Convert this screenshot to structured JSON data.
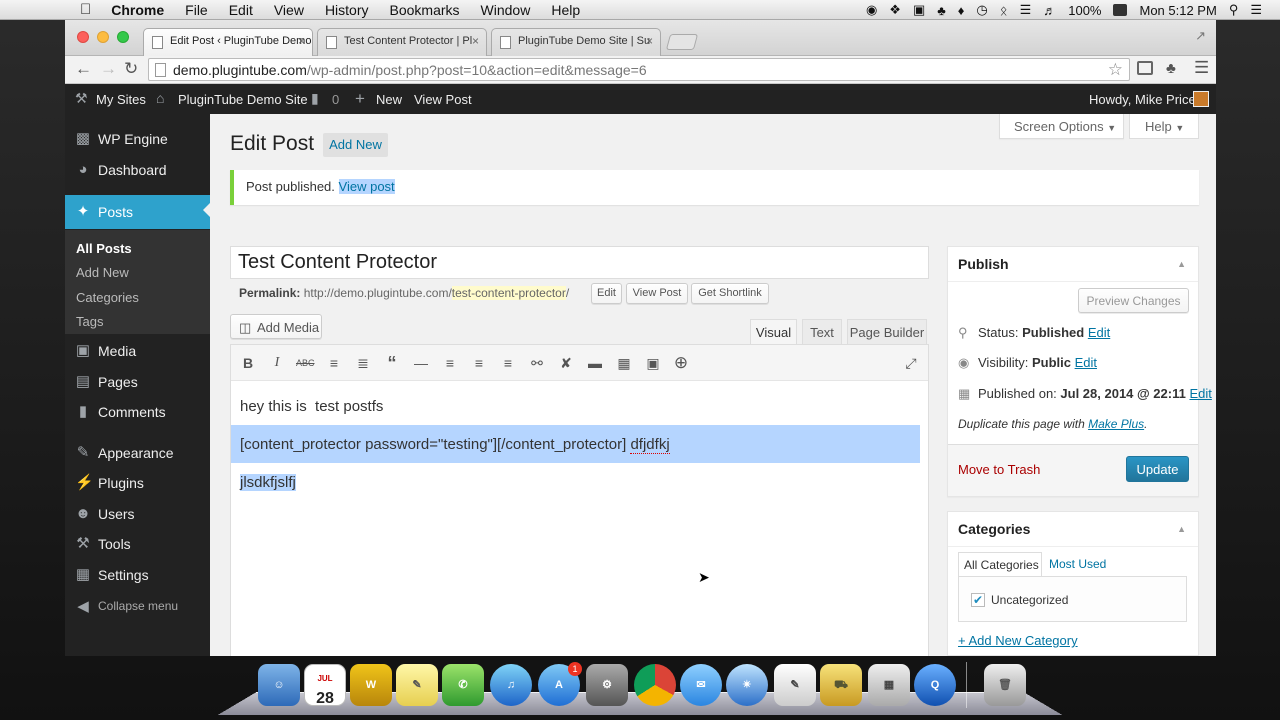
{
  "mac_menubar": {
    "app": "Chrome",
    "menus": [
      "File",
      "Edit",
      "View",
      "History",
      "Bookmarks",
      "Window",
      "Help"
    ],
    "battery": "100%",
    "clock": "Mon 5:12 PM"
  },
  "browser": {
    "tabs": [
      {
        "title": "Edit Post ‹ PluginTube Demo"
      },
      {
        "title": "Test Content Protector | Pl"
      },
      {
        "title": "PluginTube Demo Site | Su"
      }
    ],
    "url_host": "demo.plugintube.com",
    "url_path": "/wp-admin/post.php?post=10&action=edit&message=6"
  },
  "adminbar": {
    "my_sites": "My Sites",
    "site_name": "PluginTube Demo Site",
    "comments_count": "0",
    "new": "New",
    "view_post": "View Post",
    "howdy": "Howdy, Mike Price"
  },
  "sidebar": {
    "items": [
      {
        "label": "WP Engine",
        "icon": "wp-engine-icon"
      },
      {
        "label": "Dashboard",
        "icon": "dashboard-icon"
      },
      {
        "label": "Posts",
        "icon": "pin-icon"
      },
      {
        "label": "Media",
        "icon": "media-icon"
      },
      {
        "label": "Pages",
        "icon": "pages-icon"
      },
      {
        "label": "Comments",
        "icon": "comment-icon"
      },
      {
        "label": "Appearance",
        "icon": "brush-icon"
      },
      {
        "label": "Plugins",
        "icon": "plugin-icon"
      },
      {
        "label": "Users",
        "icon": "users-icon"
      },
      {
        "label": "Tools",
        "icon": "wrench-icon"
      },
      {
        "label": "Settings",
        "icon": "settings-icon"
      }
    ],
    "submenu": [
      "All Posts",
      "Add New",
      "Categories",
      "Tags"
    ],
    "collapse": "Collapse menu"
  },
  "page": {
    "screen_options": "Screen Options",
    "help": "Help",
    "title": "Edit Post",
    "add_new": "Add New",
    "notice_text": "Post published.",
    "notice_link": "View post",
    "post_title": "Test Content Protector",
    "permalink_label": "Permalink:",
    "permalink_base": "http://demo.plugintube.com/",
    "permalink_slug": "test-content-protector",
    "permalink_tail": "/",
    "edit_btn": "Edit",
    "view_post_btn": "View Post",
    "shortlink_btn": "Get Shortlink",
    "add_media": "Add Media",
    "editor_tabs": [
      "Visual",
      "Text",
      "Page Builder"
    ],
    "content_line1": "hey this is  test postfs",
    "content_line2": "[content_protector password=\"testing\"][/content_protector]",
    "content_line2_sel": "dfjdfkj",
    "content_line3": "jlsdkfjslfj"
  },
  "publish_box": {
    "title": "Publish",
    "preview": "Preview Changes",
    "status_label": "Status:",
    "status_value": "Published",
    "visibility_label": "Visibility:",
    "visibility_value": "Public",
    "published_label": "Published on:",
    "published_value": "Jul 28, 2014 @ 22:11",
    "edit": "Edit",
    "duplicate_text": "Duplicate this page with",
    "duplicate_link": "Make Plus",
    "trash": "Move to Trash",
    "update": "Update"
  },
  "categories_box": {
    "title": "Categories",
    "tabs": [
      "All Categories",
      "Most Used"
    ],
    "items": [
      {
        "label": "Uncategorized",
        "checked": true
      }
    ],
    "add_new": "+ Add New Category"
  },
  "dock": {
    "calendar_day": "28",
    "calendar_month": "JUL",
    "badge": "1"
  },
  "colors": {
    "wp_blue": "#2ea2cc",
    "admin_dark": "#222222",
    "link": "#0074a2",
    "notice_green": "#7ad03a",
    "selection": "#b5d5ff"
  }
}
